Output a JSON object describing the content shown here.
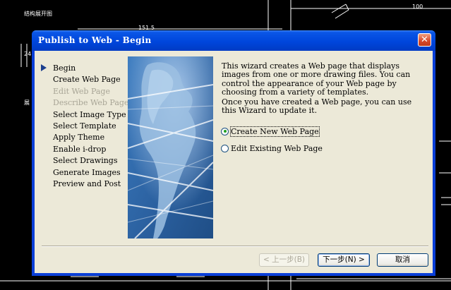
{
  "background": {
    "title_text": "结构展开图",
    "dim_top": "151.5",
    "dim_right": "100",
    "dim_left": "24",
    "side_label": "展"
  },
  "dialog": {
    "title": "Publish to Web - Begin",
    "close_glyph": "✕",
    "steps": [
      {
        "label": "Begin",
        "disabled": false,
        "current": true
      },
      {
        "label": "Create Web Page",
        "disabled": false
      },
      {
        "label": "Edit Web Page",
        "disabled": true
      },
      {
        "label": "Describe Web Page",
        "disabled": true
      },
      {
        "label": "Select Image Type",
        "disabled": false
      },
      {
        "label": "Select Template",
        "disabled": false
      },
      {
        "label": "Apply Theme",
        "disabled": false
      },
      {
        "label": "Enable i-drop",
        "disabled": false
      },
      {
        "label": "Select Drawings",
        "disabled": false
      },
      {
        "label": "Generate Images",
        "disabled": false
      },
      {
        "label": "Preview and Post",
        "disabled": false
      }
    ],
    "description_1": "This wizard creates a Web page that displays images from one or more drawing files.  You can control the appearance of your Web page by choosing from a variety of templates.",
    "description_2": "Once you have created a Web page, you can use this Wizard to update it.",
    "options": {
      "create_new": {
        "label": "Create New Web Page",
        "checked": true
      },
      "edit_existing": {
        "label": "Edit Existing Web Page",
        "checked": false
      }
    },
    "buttons": {
      "back": "< 上一步(B)",
      "next": "下一步(N) >",
      "cancel": "取消"
    },
    "colors": {
      "title_bar": "#0a56e6",
      "client": "#ece9d8",
      "banner": "#2f68a6"
    }
  }
}
